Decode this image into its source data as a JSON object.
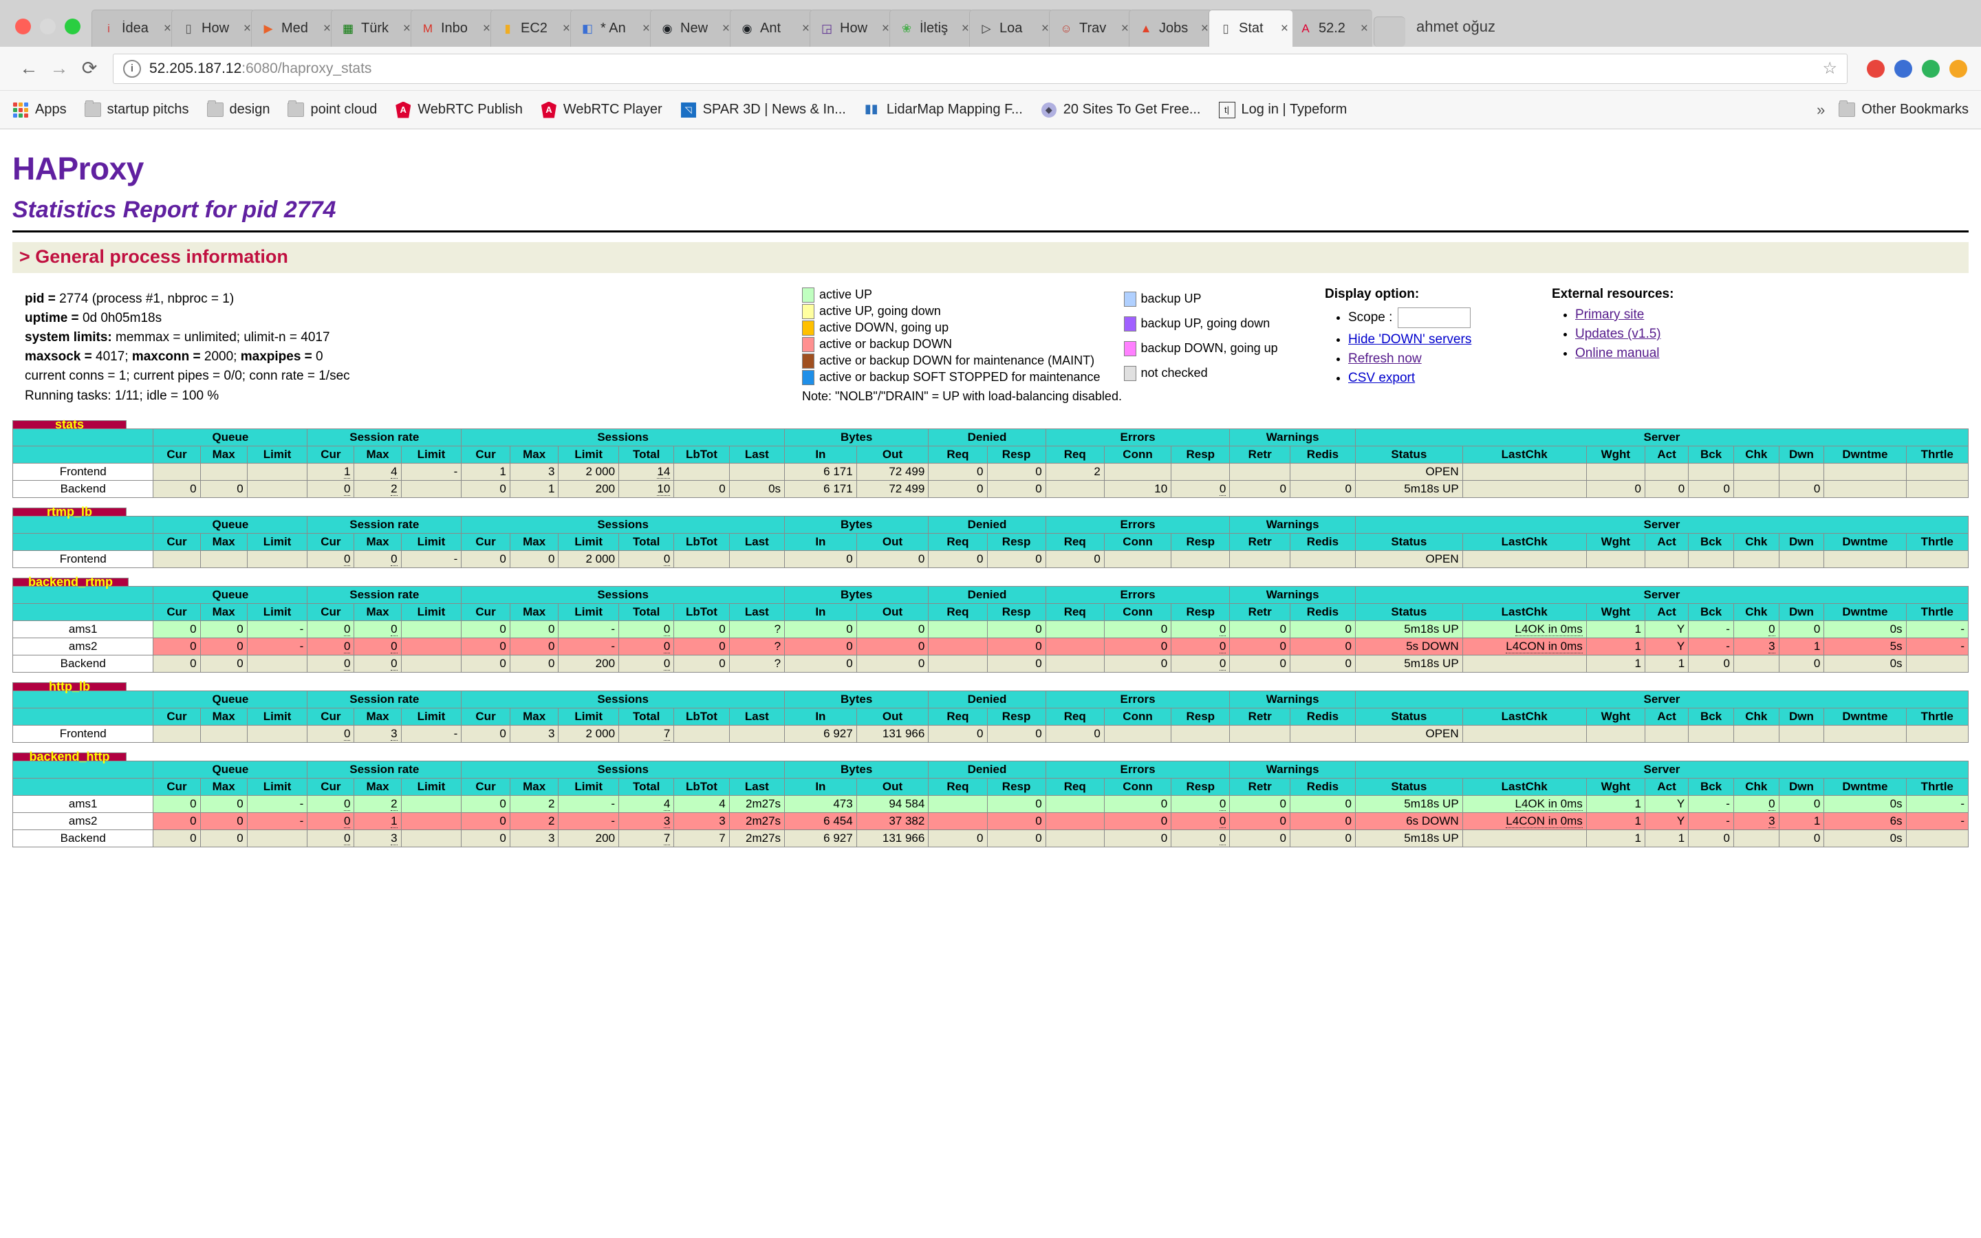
{
  "browser": {
    "tabs": [
      {
        "label": "İdea",
        "icon": "idea-icon",
        "glyph": "i",
        "color": "#d04040",
        "active": false
      },
      {
        "label": "How",
        "icon": "doc-icon",
        "glyph": "▯",
        "color": "#555555",
        "active": false
      },
      {
        "label": "Med",
        "icon": "media-icon",
        "glyph": "▶",
        "color": "#e8622a",
        "active": false
      },
      {
        "label": "Türk",
        "icon": "turk-icon",
        "glyph": "▦",
        "color": "#0a7a0a",
        "active": false
      },
      {
        "label": "Inbo",
        "icon": "gmail-icon",
        "glyph": "M",
        "color": "#d93025",
        "active": false
      },
      {
        "label": "EC2",
        "icon": "aws-ec2-icon",
        "glyph": "▮",
        "color": "#f0ad22",
        "active": false
      },
      {
        "label": "* An",
        "icon": "analytics-icon",
        "glyph": "◧",
        "color": "#3b6fd4",
        "active": false
      },
      {
        "label": "New",
        "icon": "github-icon",
        "glyph": "◉",
        "color": "#1b1f23",
        "active": false
      },
      {
        "label": "Ant",
        "icon": "github-icon",
        "glyph": "◉",
        "color": "#1b1f23",
        "active": false
      },
      {
        "label": "How",
        "icon": "gitter-icon",
        "glyph": "◲",
        "color": "#5c2d91",
        "active": false
      },
      {
        "label": "İletiş",
        "icon": "contacts-icon",
        "glyph": "❀",
        "color": "#4caf50",
        "active": false
      },
      {
        "label": "Loa",
        "icon": "play-circle-icon",
        "glyph": "▷",
        "color": "#333333",
        "active": false
      },
      {
        "label": "Trav",
        "icon": "travis-icon",
        "glyph": "☺",
        "color": "#c0392b",
        "active": false
      },
      {
        "label": "Jobs",
        "icon": "gitlab-icon",
        "glyph": "▲",
        "color": "#e24329",
        "active": false
      },
      {
        "label": "Stat",
        "icon": "doc-icon",
        "glyph": "▯",
        "color": "#555555",
        "active": true
      },
      {
        "label": "52.2",
        "icon": "angular-icon",
        "glyph": "A",
        "color": "#dd0031",
        "active": false
      }
    ],
    "profile_name": "ahmet oğuz",
    "address": {
      "host": "52.205.187.12",
      "rest": ":6080/haproxy_stats",
      "info_glyph": "i",
      "star_glyph": "☆"
    },
    "nav": {
      "back": "←",
      "forward": "→",
      "reload": "⟳"
    },
    "bookmarks": [
      {
        "label": "Apps",
        "icon": "apps-grid-icon",
        "type": "grid"
      },
      {
        "label": "startup pitchs",
        "icon": "folder-icon",
        "type": "folder"
      },
      {
        "label": "design",
        "icon": "folder-icon",
        "type": "folder"
      },
      {
        "label": "point cloud",
        "icon": "folder-icon",
        "type": "folder"
      },
      {
        "label": "WebRTC Publish",
        "icon": "angular-icon",
        "type": "ng"
      },
      {
        "label": "WebRTC Player",
        "icon": "angular-icon",
        "type": "ng"
      },
      {
        "label": "SPAR 3D | News & In...",
        "icon": "spar3d-icon",
        "type": "spar"
      },
      {
        "label": "LidarMap Mapping F...",
        "icon": "lidarmap-icon",
        "type": "lidar"
      },
      {
        "label": "20 Sites To Get Free...",
        "icon": "gem-icon",
        "type": "gem"
      },
      {
        "label": "Log in | Typeform",
        "icon": "typeform-icon",
        "type": "typeform"
      }
    ],
    "overflow_chevron": "»",
    "other_bookmarks": "Other Bookmarks"
  },
  "page": {
    "title": "HAProxy",
    "subtitle": "Statistics Report for pid 2774",
    "section_title": "> General process information",
    "process_info": [
      {
        "bold": "pid = ",
        "rest": "2774 (process #1, nbproc = 1)"
      },
      {
        "bold": "uptime = ",
        "rest": "0d 0h05m18s"
      },
      {
        "bold": "system limits: ",
        "rest": "memmax = unlimited; ulimit-n = 4017"
      },
      {
        "bold": "maxsock = ",
        "rest": "4017; ",
        "bold2": "maxconn = ",
        "rest2": "2000; ",
        "bold3": "maxpipes = ",
        "rest3": "0"
      },
      {
        "bold": "",
        "rest": "current conns = 1; current pipes = 0/0; conn rate = 1/sec"
      },
      {
        "bold": "",
        "rest": "Running tasks: 1/11; idle = 100 %"
      }
    ],
    "legend_left": [
      {
        "label": "active UP",
        "color": "#c0ffc0"
      },
      {
        "label": "active UP, going down",
        "color": "#ffffa0"
      },
      {
        "label": "active DOWN, going up",
        "color": "#ffc000"
      },
      {
        "label": "active or backup DOWN",
        "color": "#ff9090"
      },
      {
        "label": "active or backup DOWN for maintenance (MAINT)",
        "color": "#a05020"
      },
      {
        "label": "active or backup SOFT STOPPED for maintenance",
        "color": "#1f8fe8"
      }
    ],
    "legend_right": [
      {
        "label": "backup UP",
        "color": "#b0d0ff"
      },
      {
        "label": "backup UP, going down",
        "color": "#a060ff"
      },
      {
        "label": "backup DOWN, going up",
        "color": "#ff80ff"
      },
      {
        "label": "not checked",
        "color": "#e0e0e0"
      }
    ],
    "legend_note": "Note: \"NOLB\"/\"DRAIN\" = UP with load-balancing disabled.",
    "display_option": {
      "heading": "Display option:",
      "scope_label": "Scope :",
      "scope_value": "",
      "links": [
        "Hide 'DOWN' servers",
        "Refresh now",
        "CSV export"
      ]
    },
    "external_resources": {
      "heading": "External resources:",
      "links": [
        "Primary site",
        "Updates (v1.5)",
        "Online manual"
      ]
    }
  },
  "table_headers": {
    "groups": [
      "",
      "Queue",
      "Session rate",
      "Sessions",
      "Bytes",
      "Denied",
      "Errors",
      "Warnings",
      "Server"
    ],
    "queue": [
      "Cur",
      "Max",
      "Limit"
    ],
    "session_rate": [
      "Cur",
      "Max",
      "Limit"
    ],
    "sessions": [
      "Cur",
      "Max",
      "Limit",
      "Total",
      "LbTot",
      "Last"
    ],
    "bytes": [
      "In",
      "Out"
    ],
    "denied": [
      "Req",
      "Resp"
    ],
    "errors": [
      "Req",
      "Conn",
      "Resp"
    ],
    "warnings": [
      "Retr",
      "Redis"
    ],
    "server": [
      "Status",
      "LastChk",
      "Wght",
      "Act",
      "Bck",
      "Chk",
      "Dwn",
      "Dwntme",
      "Thrtle"
    ]
  },
  "proxies": [
    {
      "name": "stats",
      "rows": [
        {
          "name": "Frontend",
          "style": "rowdef",
          "q_cur": "",
          "q_max": "",
          "q_limit": "",
          "sr_cur": "1",
          "sr_max": "4",
          "sr_limit": "-",
          "s_cur": "1",
          "s_max": "3",
          "s_limit": "2 000",
          "s_total": "14",
          "s_lbtot": "",
          "s_last": "",
          "b_in": "6 171",
          "b_out": "72 499",
          "d_req": "0",
          "d_resp": "0",
          "e_req": "2",
          "e_conn": "",
          "e_resp": "",
          "w_retr": "",
          "w_redis": "",
          "status": "OPEN",
          "lastchk": "",
          "wght": "",
          "act": "",
          "bck": "",
          "chk": "",
          "dwn": "",
          "dwntme": "",
          "thrtle": ""
        },
        {
          "name": "Backend",
          "style": "rowdef",
          "q_cur": "0",
          "q_max": "0",
          "q_limit": "",
          "sr_cur": "0",
          "sr_max": "2",
          "sr_limit": "",
          "s_cur": "0",
          "s_max": "1",
          "s_limit": "200",
          "s_total": "10",
          "s_lbtot": "0",
          "s_last": "0s",
          "b_in": "6 171",
          "b_out": "72 499",
          "d_req": "0",
          "d_resp": "0",
          "e_req": "",
          "e_conn": "10",
          "e_resp": "0",
          "w_retr": "0",
          "w_redis": "0",
          "status": "5m18s UP",
          "lastchk": "",
          "wght": "0",
          "act": "0",
          "bck": "0",
          "chk": "",
          "dwn": "0",
          "dwntme": "",
          "thrtle": ""
        }
      ]
    },
    {
      "name": "rtmp_lb",
      "rows": [
        {
          "name": "Frontend",
          "style": "rowdef",
          "q_cur": "",
          "q_max": "",
          "q_limit": "",
          "sr_cur": "0",
          "sr_max": "0",
          "sr_limit": "-",
          "s_cur": "0",
          "s_max": "0",
          "s_limit": "2 000",
          "s_total": "0",
          "s_lbtot": "",
          "s_last": "",
          "b_in": "0",
          "b_out": "0",
          "d_req": "0",
          "d_resp": "0",
          "e_req": "0",
          "e_conn": "",
          "e_resp": "",
          "w_retr": "",
          "w_redis": "",
          "status": "OPEN",
          "lastchk": "",
          "wght": "",
          "act": "",
          "bck": "",
          "chk": "",
          "dwn": "",
          "dwntme": "",
          "thrtle": ""
        }
      ]
    },
    {
      "name": "backend_rtmp",
      "rows": [
        {
          "name": "ams1",
          "style": "rowup",
          "q_cur": "0",
          "q_max": "0",
          "q_limit": "-",
          "sr_cur": "0",
          "sr_max": "0",
          "sr_limit": "",
          "s_cur": "0",
          "s_max": "0",
          "s_limit": "-",
          "s_total": "0",
          "s_lbtot": "0",
          "s_last": "?",
          "b_in": "0",
          "b_out": "0",
          "d_req": "",
          "d_resp": "0",
          "e_req": "",
          "e_conn": "0",
          "e_resp": "0",
          "w_retr": "0",
          "w_redis": "0",
          "status": "5m18s UP",
          "lastchk": "L4OK in 0ms",
          "wght": "1",
          "act": "Y",
          "bck": "-",
          "chk": "0",
          "dwn": "0",
          "dwntme": "0s",
          "thrtle": "-"
        },
        {
          "name": "ams2",
          "style": "rowdown",
          "q_cur": "0",
          "q_max": "0",
          "q_limit": "-",
          "sr_cur": "0",
          "sr_max": "0",
          "sr_limit": "",
          "s_cur": "0",
          "s_max": "0",
          "s_limit": "-",
          "s_total": "0",
          "s_lbtot": "0",
          "s_last": "?",
          "b_in": "0",
          "b_out": "0",
          "d_req": "",
          "d_resp": "0",
          "e_req": "",
          "e_conn": "0",
          "e_resp": "0",
          "w_retr": "0",
          "w_redis": "0",
          "status": "5s DOWN",
          "lastchk": "L4CON in 0ms",
          "wght": "1",
          "act": "Y",
          "bck": "-",
          "chk": "3",
          "dwn": "1",
          "dwntme": "5s",
          "thrtle": "-"
        },
        {
          "name": "Backend",
          "style": "rowdef",
          "q_cur": "0",
          "q_max": "0",
          "q_limit": "",
          "sr_cur": "0",
          "sr_max": "0",
          "sr_limit": "",
          "s_cur": "0",
          "s_max": "0",
          "s_limit": "200",
          "s_total": "0",
          "s_lbtot": "0",
          "s_last": "?",
          "b_in": "0",
          "b_out": "0",
          "d_req": "",
          "d_resp": "0",
          "e_req": "",
          "e_conn": "0",
          "e_resp": "0",
          "w_retr": "0",
          "w_redis": "0",
          "status": "5m18s UP",
          "lastchk": "",
          "wght": "1",
          "act": "1",
          "bck": "0",
          "chk": "",
          "dwn": "0",
          "dwntme": "0s",
          "thrtle": ""
        }
      ]
    },
    {
      "name": "http_lb",
      "rows": [
        {
          "name": "Frontend",
          "style": "rowdef",
          "q_cur": "",
          "q_max": "",
          "q_limit": "",
          "sr_cur": "0",
          "sr_max": "3",
          "sr_limit": "-",
          "s_cur": "0",
          "s_max": "3",
          "s_limit": "2 000",
          "s_total": "7",
          "s_lbtot": "",
          "s_last": "",
          "b_in": "6 927",
          "b_out": "131 966",
          "d_req": "0",
          "d_resp": "0",
          "e_req": "0",
          "e_conn": "",
          "e_resp": "",
          "w_retr": "",
          "w_redis": "",
          "status": "OPEN",
          "lastchk": "",
          "wght": "",
          "act": "",
          "bck": "",
          "chk": "",
          "dwn": "",
          "dwntme": "",
          "thrtle": ""
        }
      ]
    },
    {
      "name": "backend_http",
      "rows": [
        {
          "name": "ams1",
          "style": "rowup",
          "q_cur": "0",
          "q_max": "0",
          "q_limit": "-",
          "sr_cur": "0",
          "sr_max": "2",
          "sr_limit": "",
          "s_cur": "0",
          "s_max": "2",
          "s_limit": "-",
          "s_total": "4",
          "s_lbtot": "4",
          "s_last": "2m27s",
          "b_in": "473",
          "b_out": "94 584",
          "d_req": "",
          "d_resp": "0",
          "e_req": "",
          "e_conn": "0",
          "e_resp": "0",
          "w_retr": "0",
          "w_redis": "0",
          "status": "5m18s UP",
          "lastchk": "L4OK in 0ms",
          "wght": "1",
          "act": "Y",
          "bck": "-",
          "chk": "0",
          "dwn": "0",
          "dwntme": "0s",
          "thrtle": "-"
        },
        {
          "name": "ams2",
          "style": "rowdown",
          "q_cur": "0",
          "q_max": "0",
          "q_limit": "-",
          "sr_cur": "0",
          "sr_max": "1",
          "sr_limit": "",
          "s_cur": "0",
          "s_max": "2",
          "s_limit": "-",
          "s_total": "3",
          "s_lbtot": "3",
          "s_last": "2m27s",
          "b_in": "6 454",
          "b_out": "37 382",
          "d_req": "",
          "d_resp": "0",
          "e_req": "",
          "e_conn": "0",
          "e_resp": "0",
          "w_retr": "0",
          "w_redis": "0",
          "status": "6s DOWN",
          "lastchk": "L4CON in 0ms",
          "wght": "1",
          "act": "Y",
          "bck": "-",
          "chk": "3",
          "dwn": "1",
          "dwntme": "6s",
          "thrtle": "-"
        },
        {
          "name": "Backend",
          "style": "rowdef",
          "q_cur": "0",
          "q_max": "0",
          "q_limit": "",
          "sr_cur": "0",
          "sr_max": "3",
          "sr_limit": "",
          "s_cur": "0",
          "s_max": "3",
          "s_limit": "200",
          "s_total": "7",
          "s_lbtot": "7",
          "s_last": "2m27s",
          "b_in": "6 927",
          "b_out": "131 966",
          "d_req": "0",
          "d_resp": "0",
          "e_req": "",
          "e_conn": "0",
          "e_resp": "0",
          "w_retr": "0",
          "w_redis": "0",
          "status": "5m18s UP",
          "lastchk": "",
          "wght": "1",
          "act": "1",
          "bck": "0",
          "chk": "",
          "dwn": "0",
          "dwntme": "0s",
          "thrtle": ""
        }
      ]
    }
  ]
}
